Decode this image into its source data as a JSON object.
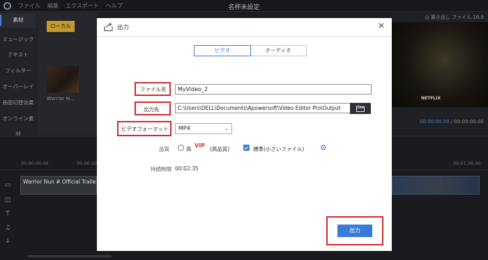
{
  "app": {
    "title": "名称未設定",
    "menu": [
      "ファイル",
      "編集",
      "エクスポート",
      "ヘルプ"
    ]
  },
  "sidebar": {
    "items": [
      {
        "label": "素材"
      },
      {
        "label": "ミュージック"
      },
      {
        "label": "テキスト"
      },
      {
        "label": "フィルター"
      },
      {
        "label": "オーバーレイ"
      },
      {
        "label": "画面切替効果"
      },
      {
        "label": "オンライン素材"
      }
    ]
  },
  "media": {
    "local_tab": "ローカル",
    "clip_name": "Warrior N..."
  },
  "preview": {
    "export_link": "◎ 書き出し ファイル 16:9",
    "watermark": "NETFLIX",
    "current_time": "00:00:00.00",
    "total_time": "/ 00:00:00.00"
  },
  "timeline": {
    "ruler": [
      "00:00:00.00",
      "00:00:10.00",
      "00:01:36.00"
    ],
    "clip_title": "Warrior Nun # Official Trailer #",
    "track_icons": [
      "video-track-icon",
      "audio-track-icon",
      "text-track-icon",
      "music-track-icon",
      "mic-track-icon"
    ]
  },
  "dialog": {
    "title": "出力",
    "tabs": [
      {
        "label": "ビデオ",
        "active": true
      },
      {
        "label": "オーディオ",
        "active": false
      }
    ],
    "filename_label": "ファイル名",
    "filename_value": "MyVideo_2",
    "output_label": "出力先",
    "output_path": "C:\\Users\\DELL\\Documents\\Apowersoft\\Video Editor Pro\\Output",
    "format_label": "ビデオフォーマット",
    "format_value": "MP4",
    "quality_label": "品質",
    "quality_high": "高",
    "quality_high_note": "(高品質)",
    "vip_badge": "VIP",
    "quality_standard": "標準(小さいファイル)",
    "duration_label": "持続時間",
    "duration_value": "00:02:35",
    "export_button": "出力"
  },
  "colors": {
    "accent": "#3a7bd5",
    "highlight": "#d12a2a",
    "local_tab": "#c49a2c"
  }
}
